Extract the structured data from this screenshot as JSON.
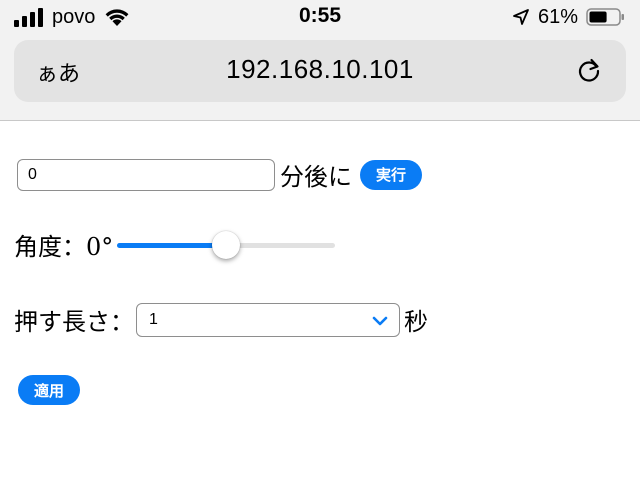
{
  "status_bar": {
    "carrier": "povo",
    "time": "0:55",
    "battery": "61%",
    "signal_icon": "signal-bars-icon",
    "wifi_icon": "wifi-icon",
    "location_icon": "location-arrow-icon",
    "battery_icon": "battery-icon",
    "battery_level": 0.61
  },
  "browser": {
    "text_size_label": "ぁあ",
    "url": "192.168.10.101",
    "reload_icon": "reload-icon"
  },
  "form": {
    "delay_input_value": "0",
    "delay_suffix": "分後に",
    "run_button": "実行",
    "angle_label": "角度：0°",
    "angle_slider_value": 0.5,
    "press_length_label": "押す長さ：",
    "press_length_selected": "1",
    "press_length_unit": "秒",
    "apply_button": "適用"
  },
  "colors": {
    "accent": "#0a7cf5",
    "chrome_bg": "#f2f2f2",
    "urlbar_bg": "#e3e3e3"
  }
}
